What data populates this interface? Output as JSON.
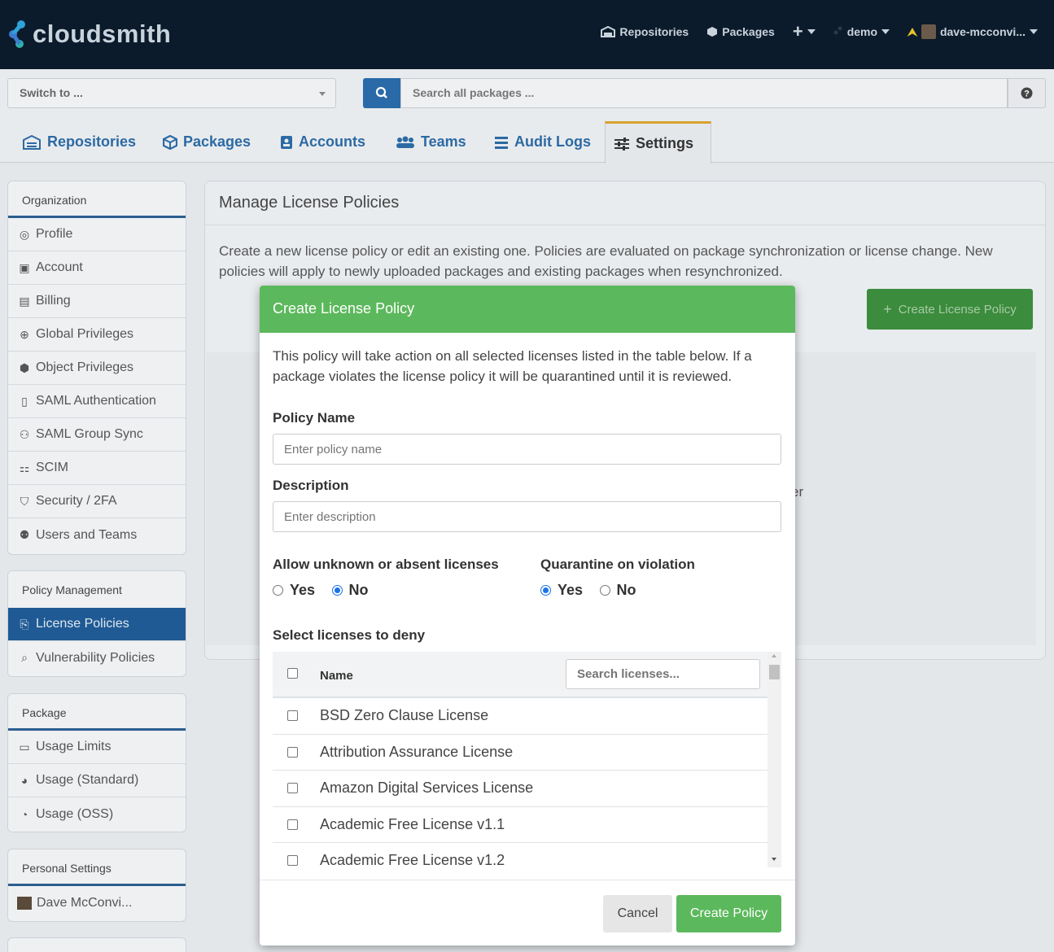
{
  "brand": {
    "name": "cloudsmith"
  },
  "topnav": {
    "repositories": "Repositories",
    "packages": "Packages",
    "workspace": "demo",
    "user": "dave-mcconvi..."
  },
  "subbar": {
    "switch_placeholder": "Switch to ...",
    "search_placeholder": "Search all packages ..."
  },
  "tabs": [
    {
      "label": "Repositories"
    },
    {
      "label": "Packages"
    },
    {
      "label": "Accounts"
    },
    {
      "label": "Teams"
    },
    {
      "label": "Audit Logs"
    },
    {
      "label": "Settings",
      "active": true
    }
  ],
  "sidebar": {
    "organization": {
      "title": "Organization",
      "items": [
        "Profile",
        "Account",
        "Billing",
        "Global Privileges",
        "Object Privileges",
        "SAML Authentication",
        "SAML Group Sync",
        "SCIM",
        "Security / 2FA",
        "Users and Teams"
      ]
    },
    "policy": {
      "title": "Policy Management",
      "items": [
        "License Policies",
        "Vulnerability Policies"
      ],
      "active": "License Policies"
    },
    "package": {
      "title": "Package",
      "items": [
        "Usage Limits",
        "Usage (Standard)",
        "Usage (OSS)"
      ]
    },
    "personal": {
      "title": "Personal Settings",
      "items": [
        "Dave McConvi..."
      ]
    }
  },
  "main": {
    "title": "Manage License Policies",
    "description": "Create a new license policy or edit an existing one. Policies are evaluated on package synchronization or license change. New policies will apply to newly uploaded packages and existing packages when resynchronized.",
    "create_button": "Create License Policy",
    "partial_text": "er"
  },
  "modal": {
    "title": "Create License Policy",
    "intro": "This policy will take action on all selected licenses listed in the table below. If a package violates the license policy it will be quarantined until it is reviewed.",
    "policy_name_label": "Policy Name",
    "policy_name_placeholder": "Enter policy name",
    "description_label": "Description",
    "description_placeholder": "Enter description",
    "allow_unknown": {
      "label": "Allow unknown or absent licenses",
      "options": [
        "Yes",
        "No"
      ],
      "selected": "No"
    },
    "quarantine": {
      "label": "Quarantine on violation",
      "options": [
        "Yes",
        "No"
      ],
      "selected": "Yes"
    },
    "deny_label": "Select licenses to deny",
    "table": {
      "header_name": "Name",
      "search_placeholder": "Search licenses...",
      "rows": [
        "BSD Zero Clause License",
        "Attribution Assurance License",
        "Amazon Digital Services License",
        "Academic Free License v1.1",
        "Academic Free License v1.2"
      ]
    },
    "cancel": "Cancel",
    "submit": "Create Policy"
  },
  "colors": {
    "navbar": "#0b1b2b",
    "accent": "#2c6aa3",
    "success": "#5cb85c",
    "active_sidebar": "#1f5a94",
    "active_tab_border": "#d9a22c"
  }
}
